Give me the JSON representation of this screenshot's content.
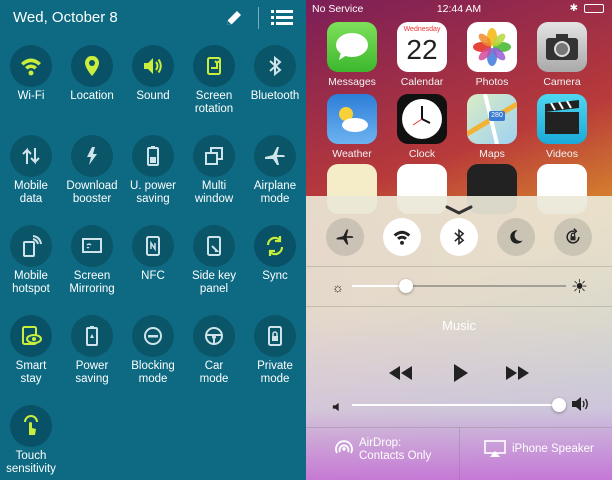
{
  "android": {
    "date": "Wed, October 8",
    "tiles": [
      {
        "name": "wifi",
        "label": "Wi-Fi",
        "icon": "wifi-icon"
      },
      {
        "name": "location",
        "label": "Location",
        "icon": "location-pin-icon"
      },
      {
        "name": "sound",
        "label": "Sound",
        "icon": "speaker-icon"
      },
      {
        "name": "screen-rotation",
        "label": "Screen\nrotation",
        "icon": "screen-rotation-icon"
      },
      {
        "name": "bluetooth",
        "label": "Bluetooth",
        "icon": "bluetooth-icon"
      },
      {
        "name": "mobile-data",
        "label": "Mobile\ndata",
        "icon": "mobile-data-icon"
      },
      {
        "name": "download-booster",
        "label": "Download\nbooster",
        "icon": "download-booster-icon"
      },
      {
        "name": "u-power-saving",
        "label": "U. power\nsaving",
        "icon": "ultra-power-saving-icon"
      },
      {
        "name": "multi-window",
        "label": "Multi\nwindow",
        "icon": "multi-window-icon"
      },
      {
        "name": "airplane-mode",
        "label": "Airplane\nmode",
        "icon": "airplane-icon"
      },
      {
        "name": "mobile-hotspot",
        "label": "Mobile\nhotspot",
        "icon": "hotspot-icon"
      },
      {
        "name": "screen-mirroring",
        "label": "Screen\nMirroring",
        "icon": "screen-mirroring-icon"
      },
      {
        "name": "nfc",
        "label": "NFC",
        "icon": "nfc-icon"
      },
      {
        "name": "side-key-panel",
        "label": "Side key\npanel",
        "icon": "side-key-panel-icon"
      },
      {
        "name": "sync",
        "label": "Sync",
        "icon": "sync-icon"
      },
      {
        "name": "smart-stay",
        "label": "Smart\nstay",
        "icon": "smart-stay-icon"
      },
      {
        "name": "power-saving",
        "label": "Power\nsaving",
        "icon": "power-saving-icon"
      },
      {
        "name": "blocking-mode",
        "label": "Blocking\nmode",
        "icon": "blocking-mode-icon"
      },
      {
        "name": "car-mode",
        "label": "Car\nmode",
        "icon": "car-mode-icon"
      },
      {
        "name": "private-mode",
        "label": "Private\nmode",
        "icon": "private-mode-icon"
      },
      {
        "name": "touch-sensitivity",
        "label": "Touch\nsensitivity",
        "icon": "touch-sensitivity-icon"
      }
    ]
  },
  "ios": {
    "status": {
      "carrier": "No Service",
      "time": "12:44 AM"
    },
    "apps": [
      {
        "label": "Messages"
      },
      {
        "label": "Calendar",
        "day": "Wednesday",
        "date": "22"
      },
      {
        "label": "Photos"
      },
      {
        "label": "Camera"
      },
      {
        "label": "Weather"
      },
      {
        "label": "Clock"
      },
      {
        "label": "Maps",
        "badge": "280"
      },
      {
        "label": "Videos"
      }
    ],
    "control_center": {
      "toggles": [
        {
          "name": "airplane",
          "on": false
        },
        {
          "name": "wifi",
          "on": true
        },
        {
          "name": "bluetooth",
          "on": true
        },
        {
          "name": "do-not-disturb",
          "on": false
        },
        {
          "name": "rotation-lock",
          "on": false
        }
      ],
      "brightness": 0.25,
      "music_title": "Music",
      "volume": 1.0,
      "airdrop_label": "AirDrop:",
      "airdrop_value": "Contacts Only",
      "speaker_label": "iPhone Speaker"
    }
  },
  "colors": {
    "android_bg": "#0d6a82",
    "android_accent": "#c9ee3b",
    "ios_toggle_on": "#ffffff"
  }
}
